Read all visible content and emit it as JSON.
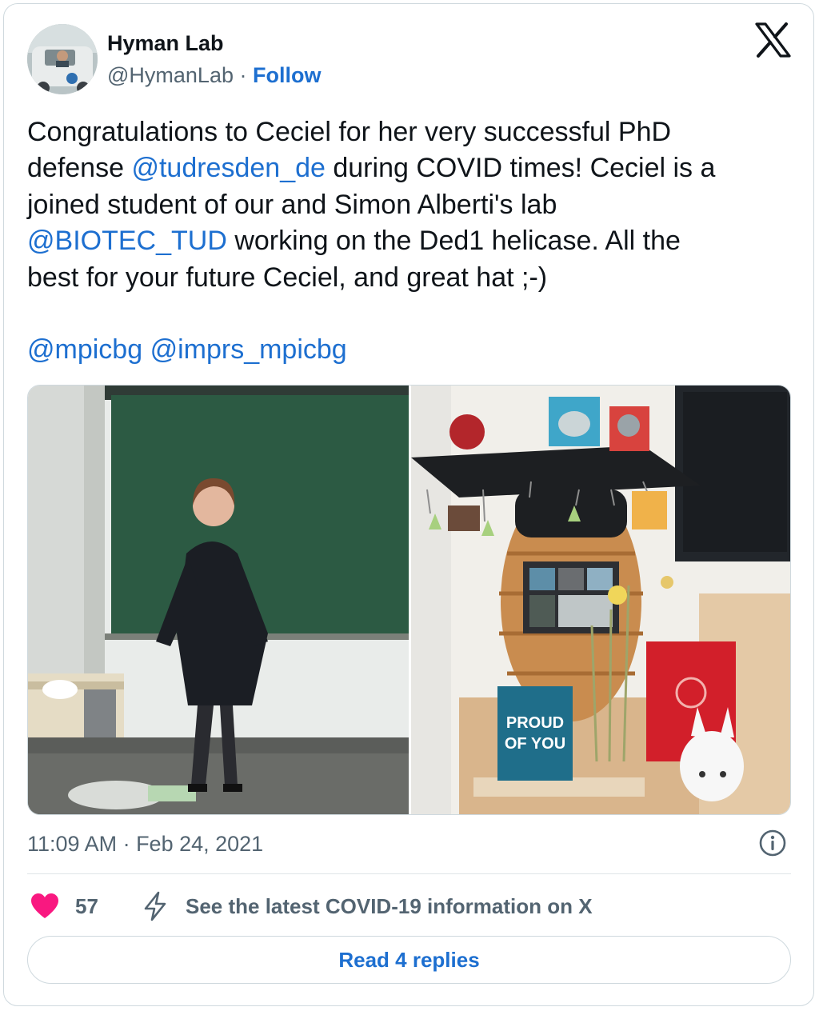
{
  "author": {
    "name": "Hyman Lab",
    "handle": "@HymanLab",
    "separator": "·",
    "follow_label": "Follow",
    "avatar_icon": "avatar-photo"
  },
  "brand": {
    "logo_icon": "x-logo-icon"
  },
  "tweet": {
    "segments": [
      {
        "type": "text",
        "text": "Congratulations to Ceciel for her very successful PhD\ndefense "
      },
      {
        "type": "mention",
        "text": "@tudresden_de"
      },
      {
        "type": "text",
        "text": " during COVID times! Ceciel is a\njoined student of our and Simon Alberti's lab\n"
      },
      {
        "type": "mention",
        "text": "@BIOTEC_TUD"
      },
      {
        "type": "text",
        "text": "  working on the Ded1 helicase. All the\nbest for your future Ceciel, and great hat ;-)\n\n"
      },
      {
        "type": "mention",
        "text": "@mpicbg"
      },
      {
        "type": "text",
        "text": " "
      },
      {
        "type": "mention",
        "text": "@imprs_mpicbg"
      }
    ]
  },
  "media": {
    "photos": [
      {
        "description_icon": "photo-lecture-room"
      },
      {
        "description_icon": "photo-graduation-hat-display"
      }
    ],
    "card_text": [
      "PROUD",
      "OF YOU"
    ]
  },
  "meta": {
    "timestamp": "11:09 AM · Feb 24, 2021",
    "info_icon": "info-icon"
  },
  "actions": {
    "like_count": "57",
    "like_icon": "heart-icon",
    "like_color": "#f91880",
    "covid_icon": "bolt-icon",
    "covid_text": "See the latest COVID-19 information on X"
  },
  "replies": {
    "label": "Read 4 replies"
  },
  "colors": {
    "accent": "#1d6fd0",
    "text": "#0f1419",
    "secondary": "#536471",
    "border": "#cfd9de"
  }
}
